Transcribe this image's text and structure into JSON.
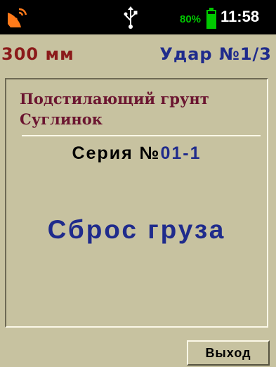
{
  "status_bar": {
    "satellite_icon": "satellite-dish-icon",
    "usb_icon": "usb-icon",
    "battery_percent": "80%",
    "battery_icon": "battery-icon",
    "time": "11:58",
    "colors": {
      "background": "#000000",
      "battery": "#00c800",
      "satellite": "#ff7a1a"
    }
  },
  "header": {
    "depth": "300 мм",
    "impact": "Удар №1/3",
    "colors": {
      "depth": "#8b1a1a",
      "impact": "#1f2b8c"
    }
  },
  "main": {
    "soil_title": "Подстилающий грунт",
    "soil_type": "Суглинок",
    "series_prefix": "Серия №",
    "series_number": "01-1",
    "status_message": "Сброс груза"
  },
  "footer": {
    "exit_label": "Выход"
  },
  "theme": {
    "background": "#c7c2a0",
    "accent_blue": "#1f2b8c",
    "accent_maroon": "#6b1530"
  }
}
